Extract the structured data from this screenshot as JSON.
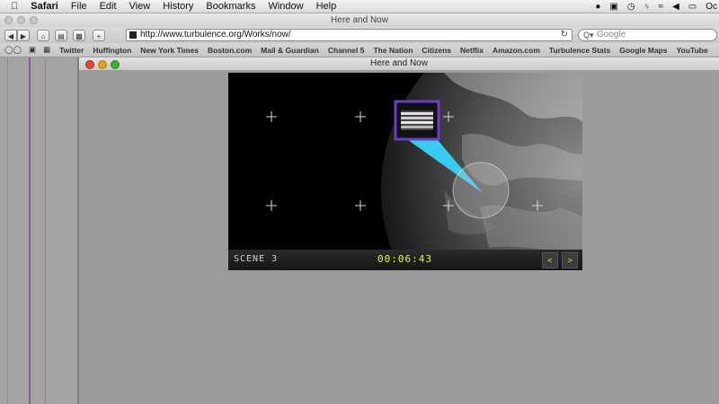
{
  "menubar": {
    "app": "Safari",
    "items": [
      "File",
      "Edit",
      "View",
      "History",
      "Bookmarks",
      "Window",
      "Help"
    ],
    "status_icons": [
      "record-icon",
      "display-icon",
      "time-machine-icon",
      "bluetooth-icon",
      "wifi-icon",
      "volume-icon",
      "battery-icon"
    ],
    "clock": "Oc"
  },
  "window": {
    "title": "Here and Now"
  },
  "toolbar": {
    "back": "◀",
    "forward": "▶",
    "url": "http://www.turbulence.org/Works/now/",
    "search_placeholder": "Google"
  },
  "bookmarks": [
    "Twitter",
    "Huffington",
    "New York Times",
    "Boston.com",
    "Mail & Guardian",
    "Channel 5",
    "The Nation",
    "Citizens",
    "Netflix",
    "Amazon.com",
    "Turbulence Stats",
    "Google Maps",
    "YouTube"
  ],
  "inner_window": {
    "title": "Here and Now"
  },
  "player": {
    "scene_label": "SCENE 3",
    "timecode": "00:06:43",
    "prev": "<",
    "next": ">"
  },
  "colors": {
    "accent_pointer": "#3ad7ff",
    "inset_border": "#6a3cc8",
    "timecode": "#d7ff2e"
  }
}
